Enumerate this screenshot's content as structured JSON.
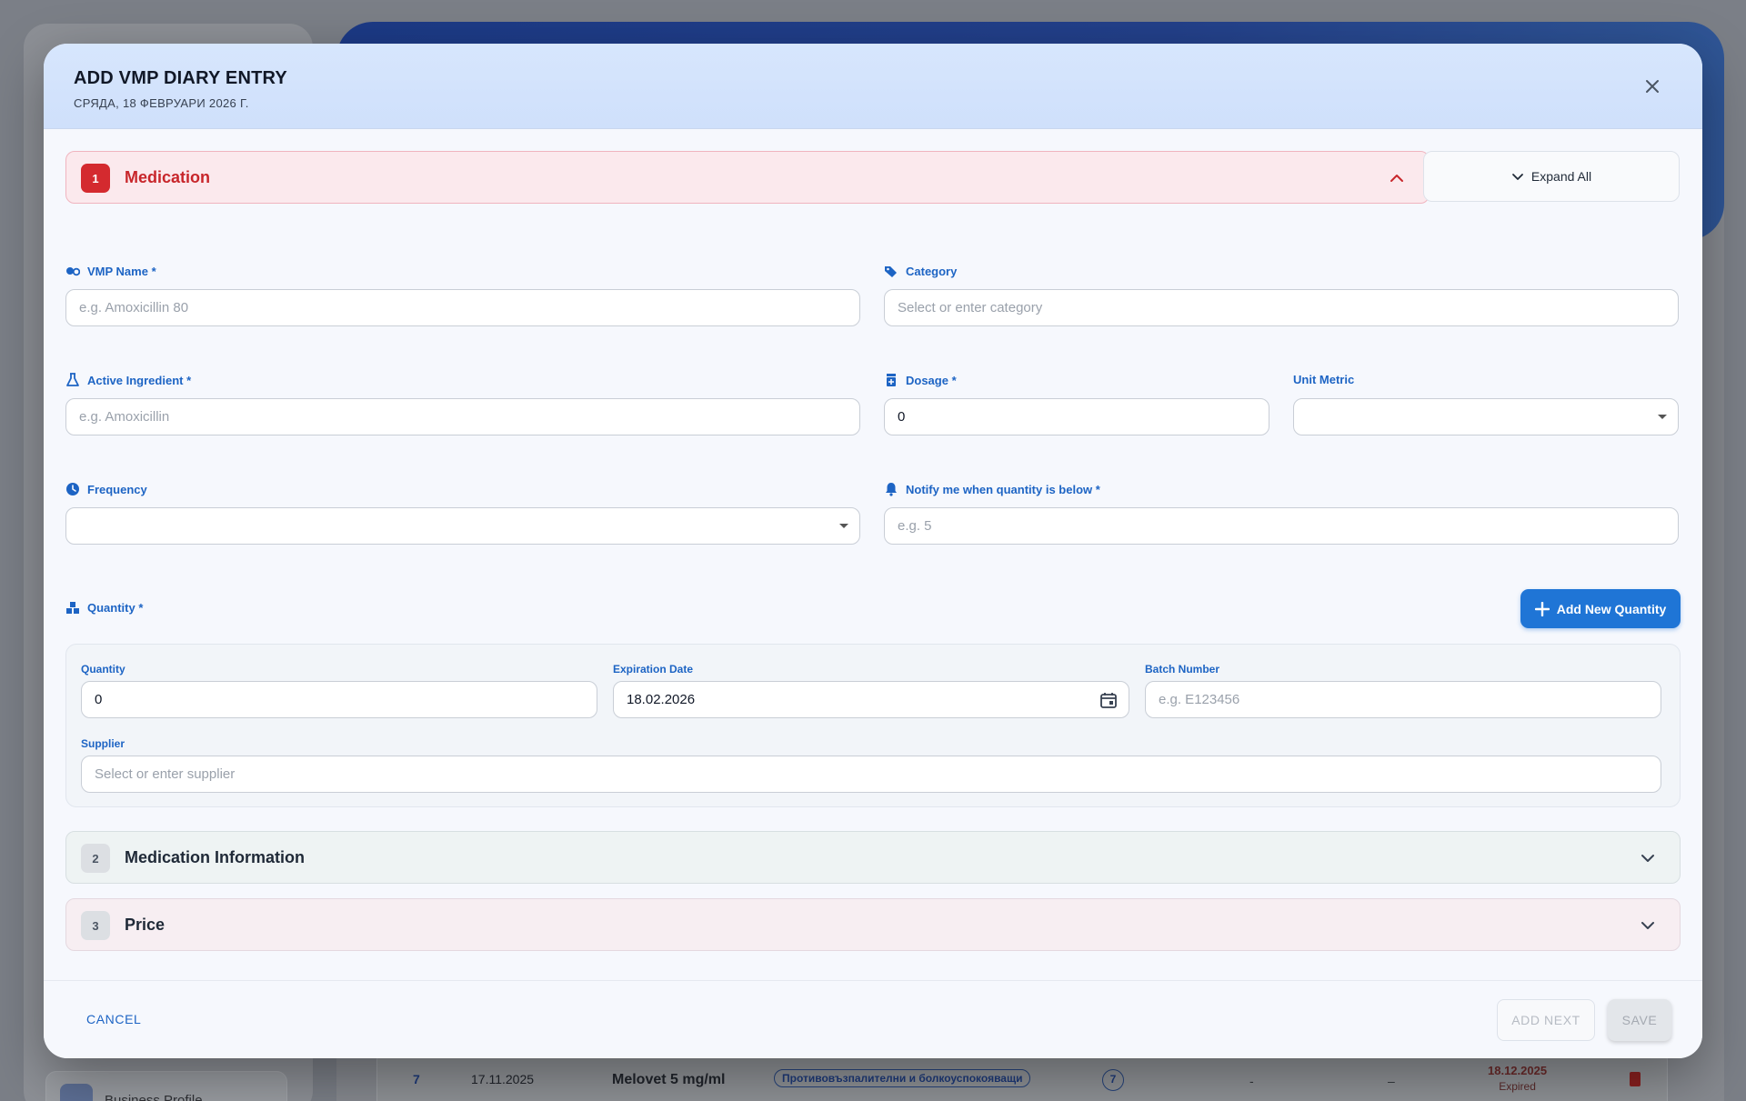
{
  "background": {
    "sidebar_item_label": "Business Profile",
    "row": {
      "num": "7",
      "date": "17.11.2025",
      "name": "Melovet 5 mg/ml",
      "tag": "Противовъзпалителни и болкоуспокояващи",
      "count": "7",
      "col_a": "-",
      "col_b": "–",
      "exp_date": "18.12.2025",
      "exp_status": "Expired"
    }
  },
  "modal": {
    "title": "ADD VMP DIARY ENTRY",
    "subtitle": "СРЯДА, 18 ФЕВРУАРИ 2026 Г.",
    "expand_all": "Expand All",
    "sections": [
      {
        "num": "1",
        "label": "Medication"
      },
      {
        "num": "2",
        "label": "Medication Information"
      },
      {
        "num": "3",
        "label": "Price"
      }
    ],
    "fields": {
      "vmp_name": {
        "label": "VMP Name *",
        "placeholder": "e.g. Amoxicillin 80",
        "value": ""
      },
      "category": {
        "label": "Category",
        "placeholder": "Select or enter category",
        "value": ""
      },
      "active_ingredient": {
        "label": "Active Ingredient *",
        "placeholder": "e.g. Amoxicillin",
        "value": ""
      },
      "dosage": {
        "label": "Dosage *",
        "value": "0"
      },
      "unit_metric": {
        "label": "Unit Metric",
        "value": ""
      },
      "frequency": {
        "label": "Frequency",
        "value": ""
      },
      "notify": {
        "label": "Notify me when quantity is below *",
        "placeholder": "e.g. 5",
        "value": ""
      }
    },
    "quantity": {
      "label": "Quantity *",
      "add_button": "Add New Quantity",
      "qty_label": "Quantity",
      "qty_value": "0",
      "exp_label": "Expiration Date",
      "exp_value": "18.02.2026",
      "batch_label": "Batch Number",
      "batch_placeholder": "e.g. E123456",
      "supplier_label": "Supplier",
      "supplier_placeholder": "Select or enter supplier"
    },
    "footer": {
      "cancel": "CANCEL",
      "add_next": "ADD NEXT",
      "save": "SAVE"
    }
  },
  "colors": {
    "accent": "#1d64c4",
    "danger": "#d42a2f",
    "primary_button": "#1f75d6"
  }
}
